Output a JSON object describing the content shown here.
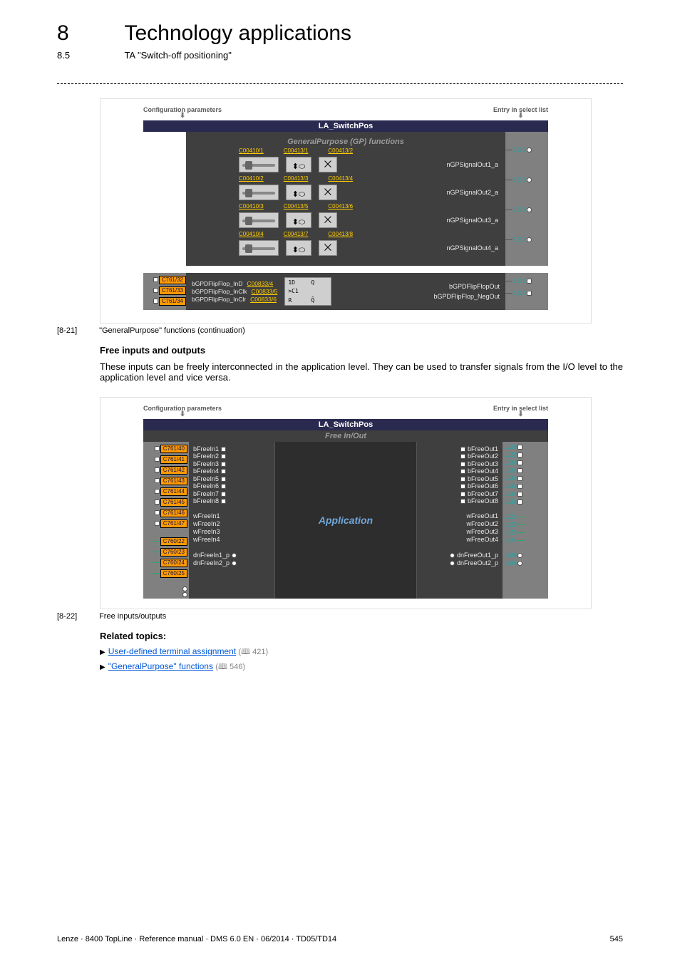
{
  "header": {
    "chap_num": "8",
    "chap_title": "Technology applications",
    "sec_num": "8.5",
    "sec_title": "TA \"Switch-off positioning\""
  },
  "labels": {
    "config_params": "Configuration parameters",
    "entry_select": "Entry in select list"
  },
  "gp_diagram": {
    "title": "LA_SwitchPos",
    "subtitle": "GeneralPurpose (GP) functions",
    "rows": [
      {
        "p1": "C00410/1",
        "p2": "C00413/1",
        "p3": "C00413/2",
        "out": "nGPSignalOut1_a",
        "outnum": "1212"
      },
      {
        "p1": "C00410/2",
        "p2": "C00413/3",
        "p3": "C00413/4",
        "out": "nGPSignalOut2_a",
        "outnum": "1213"
      },
      {
        "p1": "C00410/3",
        "p2": "C00413/5",
        "p3": "C00413/6",
        "out": "nGPSignalOut3_a",
        "outnum": "1214"
      },
      {
        "p1": "C00410/4",
        "p2": "C00413/7",
        "p3": "C00413/8",
        "out": "nGPSignalOut4_a",
        "outnum": "1215"
      }
    ],
    "ff": {
      "in_tags": [
        "C761/32",
        "C761/33",
        "C761/34"
      ],
      "in_labels": [
        "bGPDFlipFlop_InD",
        "bGPDFlipFlop_InClk",
        "bGPDFlipFlop_InClr"
      ],
      "in_params": [
        "C00833/4",
        "C00833/5",
        "C00833/6"
      ],
      "chip": [
        "1D",
        "Q",
        ">C1",
        "",
        "R",
        "Q̄"
      ],
      "out_labels": [
        "bGPDFlipFlopOut",
        "bGPDFlipFlop_NegOut"
      ],
      "out_nums": [
        "1217",
        "1218"
      ]
    }
  },
  "caption1_num": "[8-21]",
  "caption1_txt": "\"GeneralPurpose\" functions (continuation)",
  "section_free_title": "Free inputs and outputs",
  "section_free_para": "These inputs can be freely interconnected in the application level. They can be used to transfer signals from the I/O level to the application level and vice versa.",
  "free_diagram": {
    "title": "LA_SwitchPos",
    "subtitle": "Free In/Out",
    "center": "Application",
    "b_in_tags": [
      "C761/40",
      "C761/41",
      "C761/42",
      "C761/43",
      "C761/44",
      "C761/45",
      "C761/46",
      "C761/47"
    ],
    "b_in": [
      "bFreeIn1",
      "bFreeIn2",
      "bFreeIn3",
      "bFreeIn4",
      "bFreeIn5",
      "bFreeIn6",
      "bFreeIn7",
      "bFreeIn8"
    ],
    "w_in_tags": [
      "C760/22",
      "C760/23",
      "C760/24",
      "C760/25"
    ],
    "w_in": [
      "wFreeIn1",
      "wFreeIn2",
      "wFreeIn3",
      "wFreeIn4"
    ],
    "dn_in": [
      "dnFreeIn1_p",
      "dnFreeIn2_p"
    ],
    "b_out": [
      "bFreeOut1",
      "bFreeOut2",
      "bFreeOut3",
      "bFreeOut4",
      "bFreeOut5",
      "bFreeOut6",
      "bFreeOut7",
      "bFreeOut8"
    ],
    "b_out_nums": [
      "1228",
      "1229",
      "1230",
      "1231",
      "1232",
      "1233",
      "1234",
      "1235"
    ],
    "w_out": [
      "wFreeOut1",
      "wFreeOut2",
      "wFreeOut3",
      "wFreeOut4"
    ],
    "w_out_nums": [
      "1221",
      "1222",
      "1223",
      "1224"
    ],
    "dn_out": [
      "dnFreeOut1_p",
      "dnFreeOut2_p"
    ],
    "dn_out_nums": [
      "1205",
      "1206"
    ]
  },
  "caption2_num": "[8-22]",
  "caption2_txt": "Free inputs/outputs",
  "related_title": "Related topics:",
  "links": [
    {
      "text": "User-defined terminal assignment",
      "ref": "421"
    },
    {
      "text": "\"GeneralPurpose\" functions",
      "ref": "546"
    }
  ],
  "footer_left": "Lenze · 8400 TopLine · Reference manual · DMS 6.0 EN · 06/2014 · TD05/TD14",
  "footer_right": "545",
  "book_icon": "🕮"
}
